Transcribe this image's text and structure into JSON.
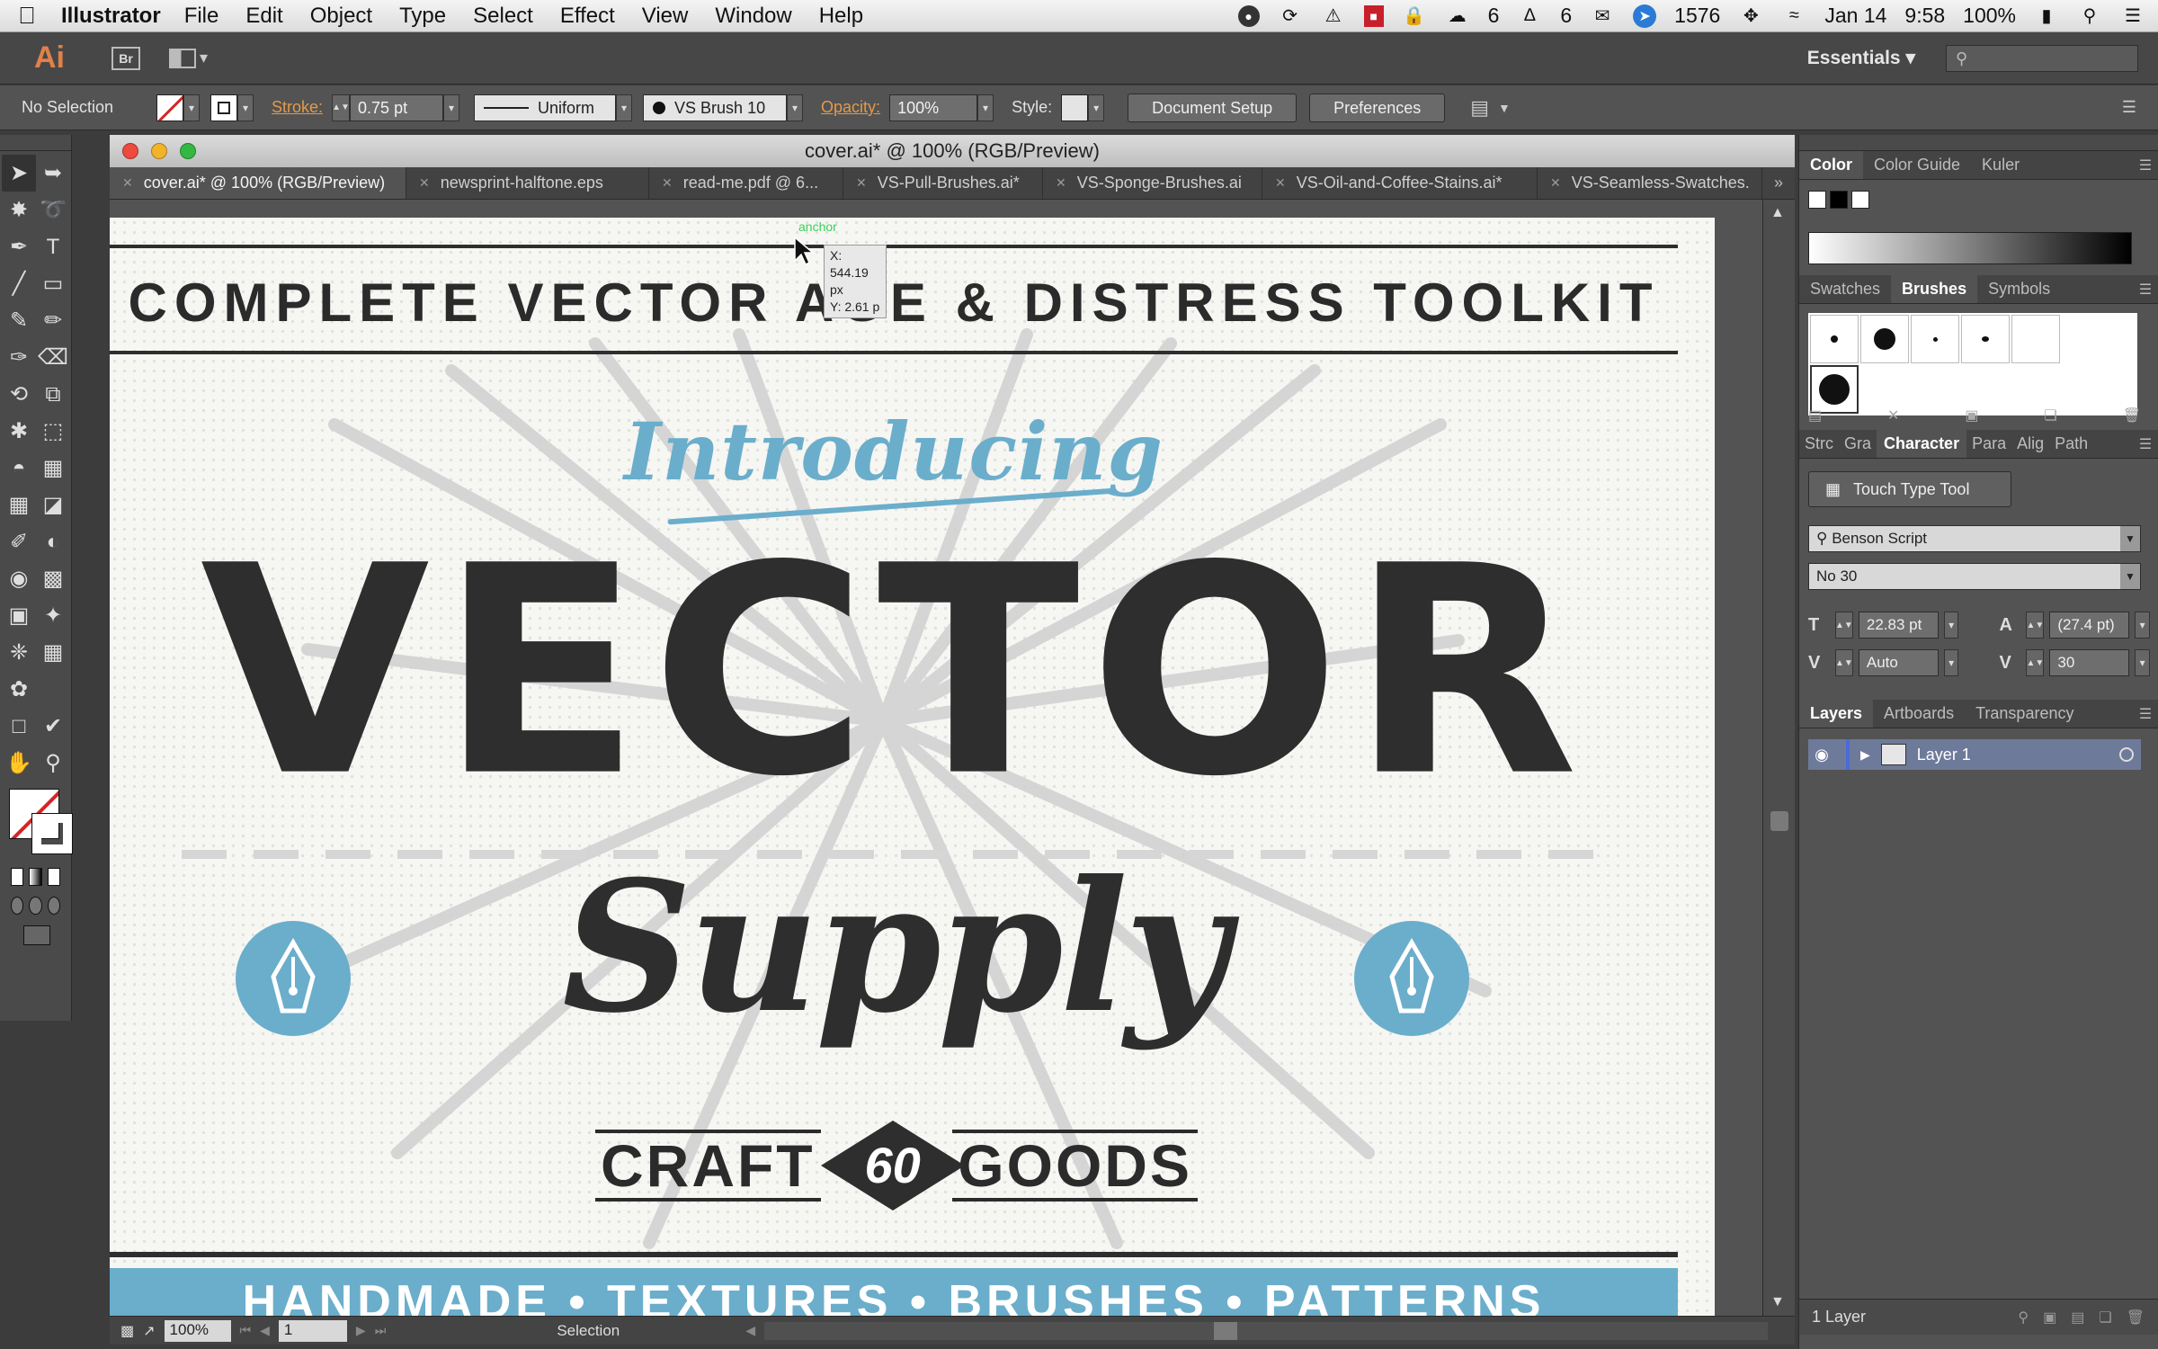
{
  "menubar": {
    "app_name": "Illustrator",
    "menus": [
      "File",
      "Edit",
      "Object",
      "Type",
      "Select",
      "Effect",
      "View",
      "Window",
      "Help"
    ],
    "status": {
      "badge_a": "6",
      "badge_b": "6",
      "badge_c": "1576",
      "date": "Jan 14",
      "time": "9:58",
      "battery": "100%"
    }
  },
  "appbar": {
    "logo": "Ai",
    "bridge": "Br",
    "workspace": "Essentials"
  },
  "controlbar": {
    "selection": "No Selection",
    "stroke_label": "Stroke:",
    "stroke_weight": "0.75 pt",
    "profile": "Uniform",
    "brush": "VS Brush 10",
    "opacity_label": "Opacity:",
    "opacity": "100%",
    "style_label": "Style:",
    "document_setup": "Document Setup",
    "preferences": "Preferences"
  },
  "document": {
    "window_title": "cover.ai* @ 100% (RGB/Preview)",
    "tabs": [
      {
        "label": "cover.ai* @ 100% (RGB/Preview)",
        "active": true
      },
      {
        "label": "newsprint-halftone.eps",
        "active": false
      },
      {
        "label": "read-me.pdf @ 6...",
        "active": false
      },
      {
        "label": "VS-Pull-Brushes.ai*",
        "active": false
      },
      {
        "label": "VS-Sponge-Brushes.ai",
        "active": false
      },
      {
        "label": "VS-Oil-and-Coffee-Stains.ai*",
        "active": false
      },
      {
        "label": "VS-Seamless-Swatches.",
        "active": false
      }
    ]
  },
  "artwork": {
    "heading": "COMPLETE VECTOR AGE & DISTRESS TOOLKIT",
    "intro": "Introducing",
    "main": "VECTOR",
    "script": "Supply",
    "left_word": "CRAFT",
    "badge_number": "60",
    "right_word": "GOODS",
    "banner": "HANDMADE • TEXTURES • BRUSHES • PATTERNS"
  },
  "cursor": {
    "hint": "anchor",
    "x_readout": "X: 544.19 px",
    "y_readout": "Y: 2.61 p"
  },
  "statusbar": {
    "zoom": "100%",
    "page": "1",
    "tool": "Selection"
  },
  "panels": {
    "color_tabs": [
      "Color",
      "Color Guide",
      "Kuler"
    ],
    "brush_tabs": [
      "Swatches",
      "Brushes",
      "Symbols"
    ],
    "char_tabs": [
      "Strc",
      "Gra",
      "Character",
      "Para",
      "Alig",
      "Path"
    ],
    "touch_type": "Touch Type Tool",
    "font_family": "Benson Script",
    "font_style": "No 30",
    "font_size": "22.83 pt",
    "leading": "(27.4 pt)",
    "kerning": "Auto",
    "tracking": "30",
    "layer_tabs": [
      "Layers",
      "Artboards",
      "Transparency"
    ],
    "layer_name": "Layer 1",
    "layer_count": "1 Layer"
  },
  "colors": {
    "accent_blue": "#6aaecb",
    "ink": "#2e2e2e",
    "ui_dark": "#535353"
  }
}
